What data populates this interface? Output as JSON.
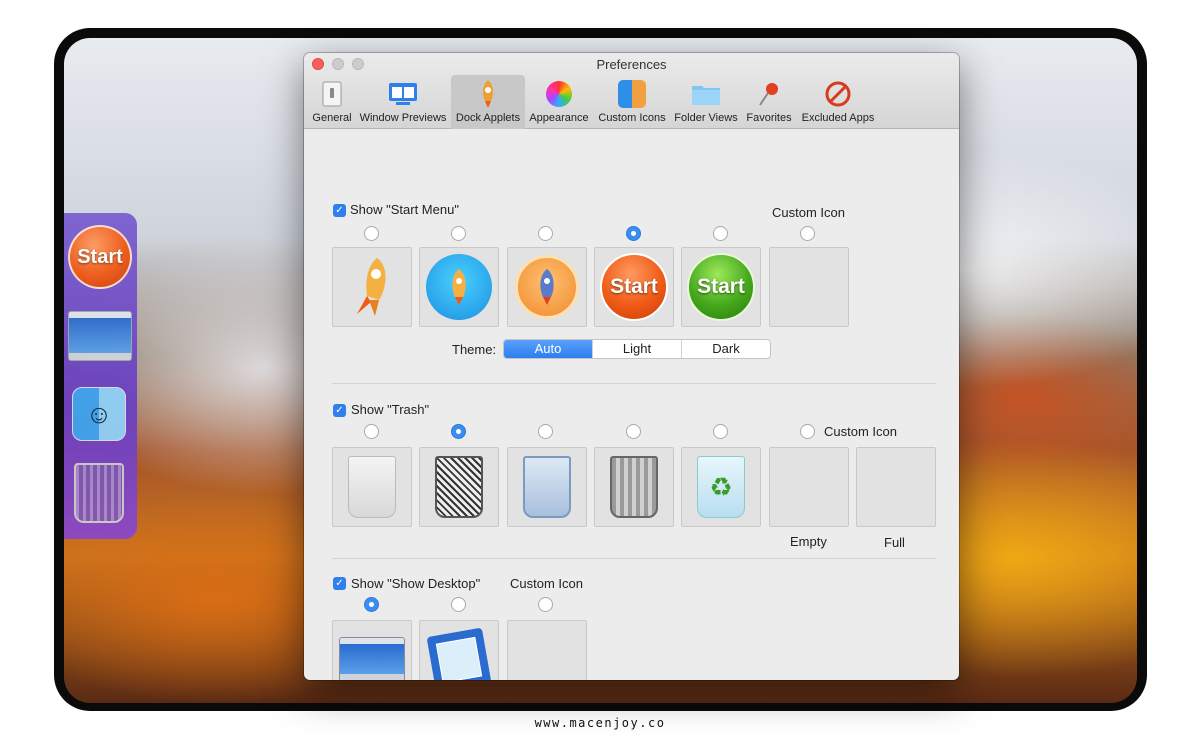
{
  "window": {
    "title": "Preferences",
    "traffic_colors": [
      "#fc605c",
      "#c8c8c8",
      "#c8c8c8"
    ]
  },
  "toolbar": {
    "tabs": [
      {
        "label": "General",
        "icon": "switch-icon"
      },
      {
        "label": "Window Previews",
        "icon": "window-previews-icon"
      },
      {
        "label": "Dock Applets",
        "icon": "rocket-icon",
        "active": true
      },
      {
        "label": "Appearance",
        "icon": "color-wheel-icon"
      },
      {
        "label": "Custom Icons",
        "icon": "finder-icon"
      },
      {
        "label": "Folder Views",
        "icon": "folder-icon"
      },
      {
        "label": "Favorites",
        "icon": "pushpin-icon"
      },
      {
        "label": "Excluded Apps",
        "icon": "prohibited-icon"
      }
    ]
  },
  "start_menu": {
    "checkbox_label": "Show \"Start Menu\"",
    "checked": true,
    "custom_icon_label": "Custom Icon",
    "selected_index": 3,
    "options": [
      {
        "name": "rocket-plain-icon"
      },
      {
        "name": "rocket-blue-circle-icon"
      },
      {
        "name": "rocket-orange-circle-icon"
      },
      {
        "name": "start-orange-orb-icon",
        "text": "Start"
      },
      {
        "name": "start-green-orb-icon",
        "text": "Start"
      },
      {
        "name": "custom-icon-well"
      }
    ],
    "theme_label": "Theme:",
    "theme_options": [
      "Auto",
      "Light",
      "Dark"
    ],
    "theme_selected": "Auto"
  },
  "trash": {
    "checkbox_label": "Show \"Trash\"",
    "checked": true,
    "custom_icon_label": "Custom Icon",
    "selected_index": 1,
    "empty_label": "Empty",
    "full_label": "Full",
    "options": [
      {
        "name": "trash-translucent-icon"
      },
      {
        "name": "trash-mesh-icon"
      },
      {
        "name": "trash-blue-icon"
      },
      {
        "name": "trash-metal-icon"
      },
      {
        "name": "trash-recycle-icon"
      }
    ]
  },
  "show_desktop": {
    "checkbox_label": "Show \"Show Desktop\"",
    "checked": true,
    "custom_icon_label": "Custom Icon",
    "selected_index": 0,
    "options": [
      {
        "name": "desktop-screen-icon"
      },
      {
        "name": "desktop-edit-icon"
      },
      {
        "name": "custom-icon-well"
      }
    ]
  },
  "dock": {
    "start_text": "Start",
    "items": [
      "start-button-icon",
      "show-desktop-icon",
      "finder-icon",
      "trash-icon"
    ]
  },
  "footer": {
    "caption": "www.macenjoy.co"
  },
  "colors": {
    "accent": "#2f7fed",
    "start_orange": "#f05a16",
    "start_green": "#44a81c",
    "dock_purple": "#6a40c0"
  }
}
